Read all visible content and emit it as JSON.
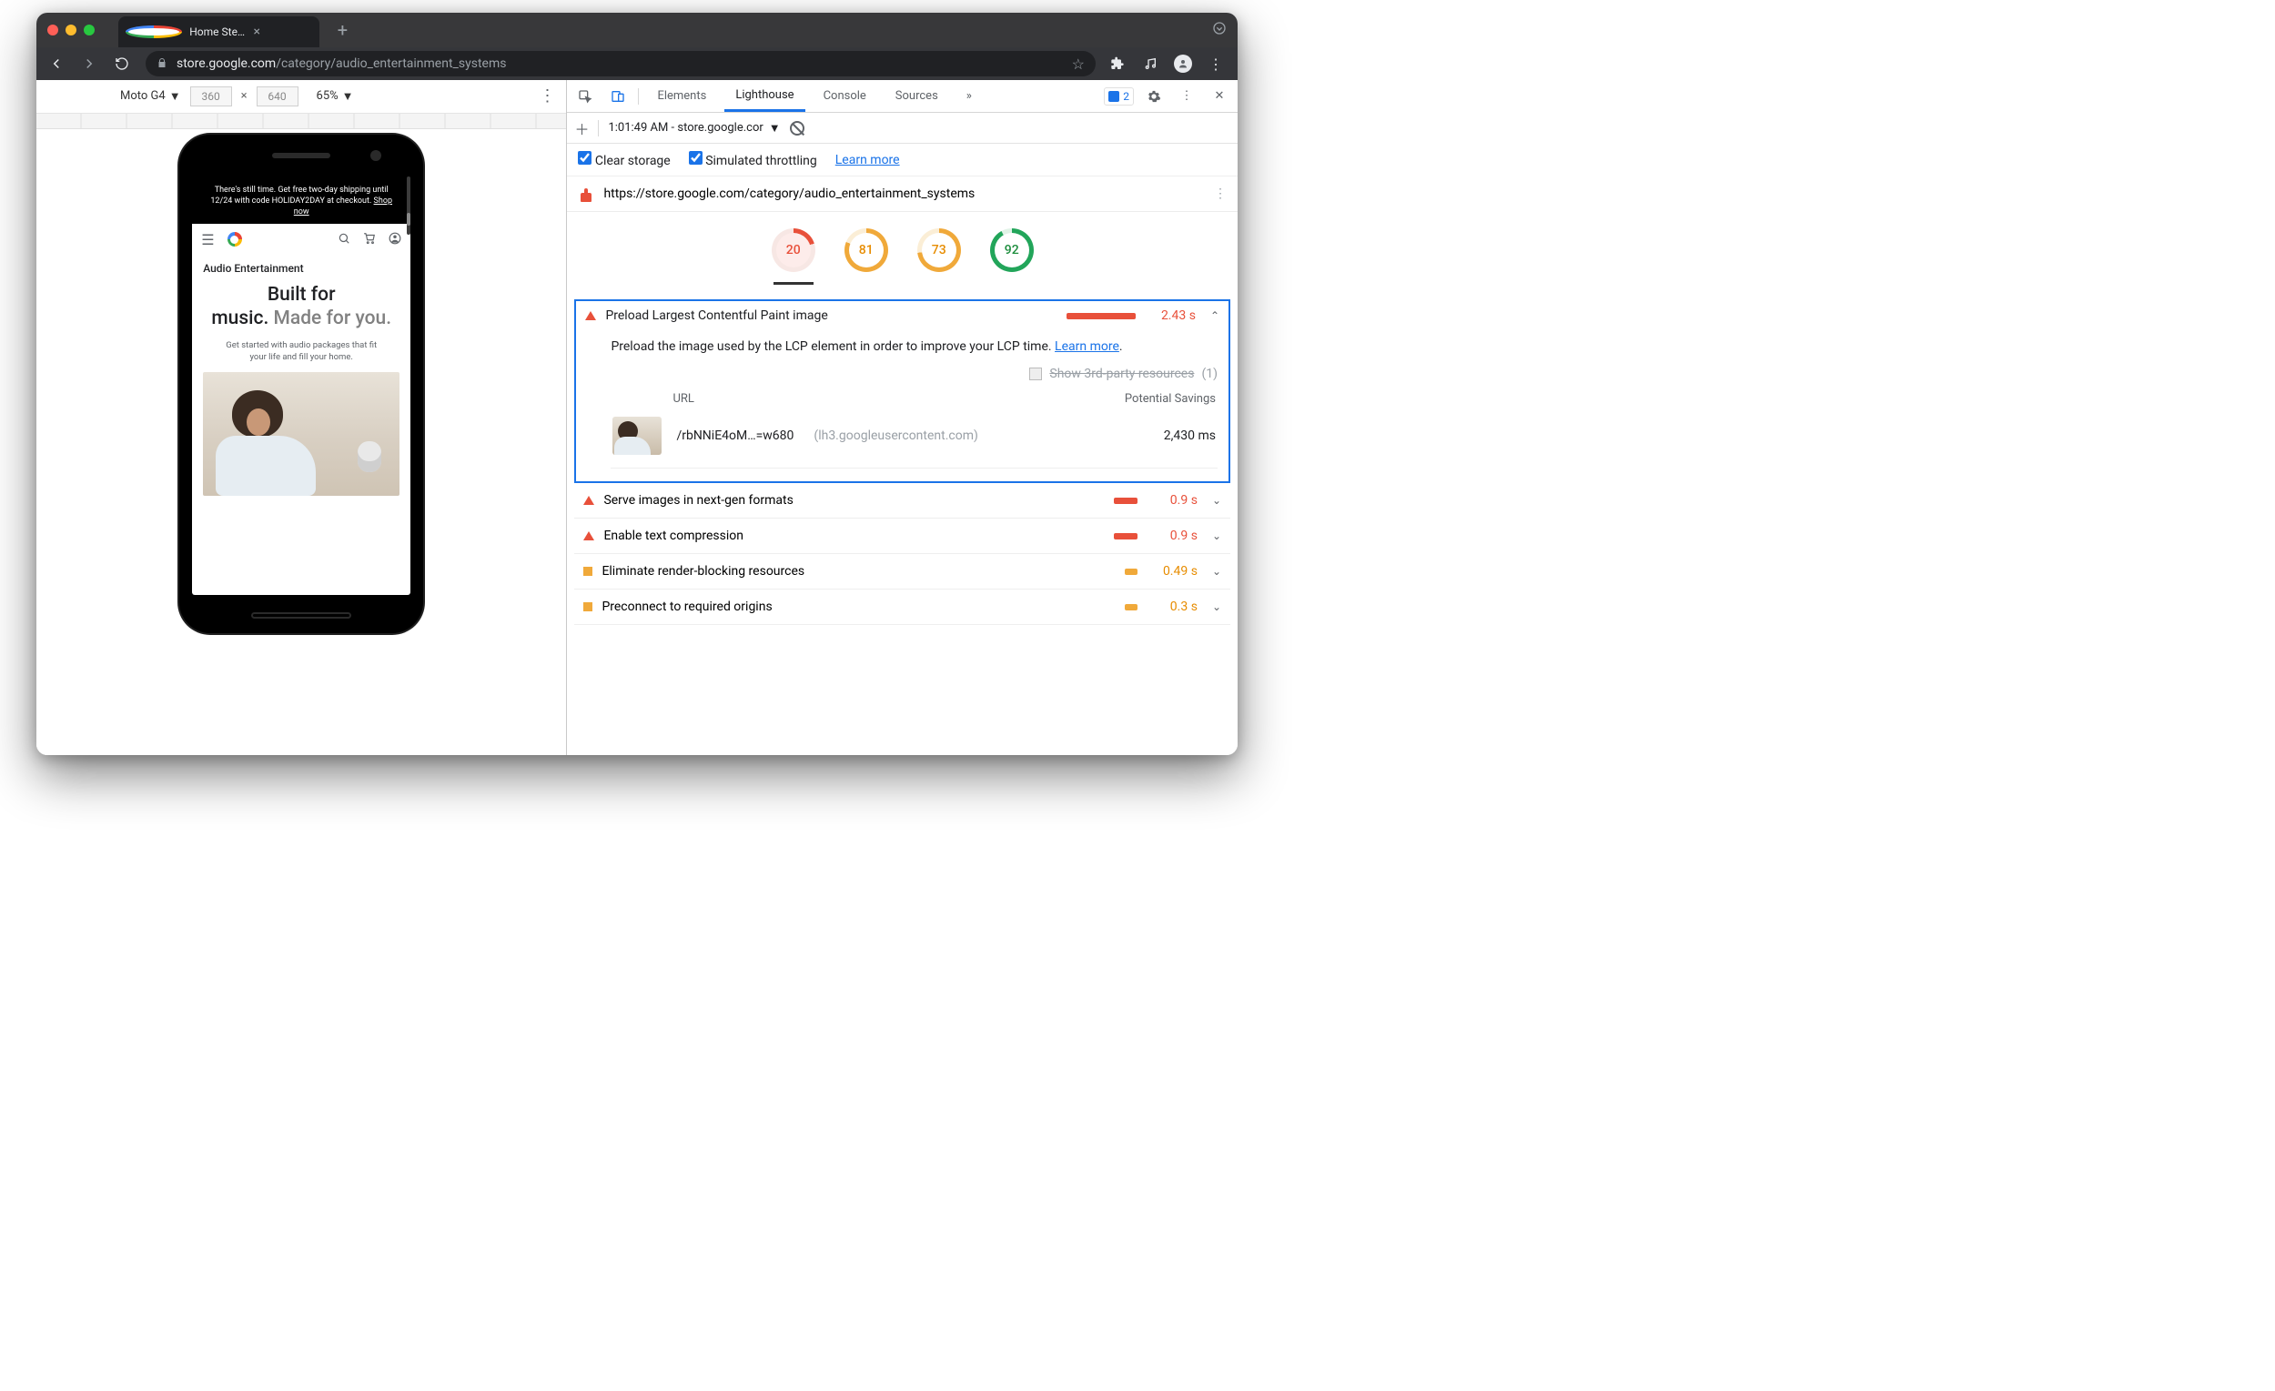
{
  "browser": {
    "tab_title": "Home Stereo & Audio Entertain",
    "url_full": "store.google.com/category/audio_entertainment_systems",
    "url_host": "store.google.com",
    "url_path": "/category/audio_entertainment_systems"
  },
  "emulation": {
    "device": "Moto G4",
    "width": "360",
    "height": "640",
    "zoom": "65%"
  },
  "phone_page": {
    "banner_line1": "There's still time. Get free two-day shipping until",
    "banner_line2": "12/24 with code HOLIDAY2DAY at checkout. ",
    "banner_cta": "Shop now",
    "section_title": "Audio Entertainment",
    "hero_black1": "Built for",
    "hero_black2": "music.",
    "hero_grey": " Made for you.",
    "sub": "Get started with audio packages that fit your life and fill your home."
  },
  "devtools": {
    "tabs": [
      "Elements",
      "Lighthouse",
      "Console",
      "Sources"
    ],
    "active_tab": "Lighthouse",
    "issues_count": "2",
    "report_time": "1:01:49 AM - store.google.cor",
    "clear_storage": "Clear storage",
    "throttling": "Simulated throttling",
    "learn_more": "Learn more",
    "target_url": "https://store.google.com/category/audio_entertainment_systems",
    "scores": {
      "perf": "20",
      "a11y": "81",
      "bp": "73",
      "seo": "92"
    }
  },
  "audit": {
    "title": "Preload Largest Contentful Paint image",
    "time": "2.43 s",
    "desc_a": "Preload the image used by the LCP element in order to improve your LCP time. ",
    "desc_link": "Learn more",
    "desc_b": ".",
    "third_party_label": "Show 3rd-party resources",
    "third_party_count": "(1)",
    "col_url": "URL",
    "col_savings": "Potential Savings",
    "row_path": "/rbNNiE4oM…=w680",
    "row_domain": "(lh3.googleusercontent.com)",
    "row_savings": "2,430 ms"
  },
  "other_audits": [
    {
      "icon": "tri",
      "title": "Serve images in next-gen formats",
      "barClass": "sm",
      "val": "0.9 s",
      "valClass": ""
    },
    {
      "icon": "tri",
      "title": "Enable text compression",
      "barClass": "sm",
      "val": "0.9 s",
      "valClass": ""
    },
    {
      "icon": "sq",
      "title": "Eliminate render-blocking resources",
      "barClass": "tiny amber",
      "val": "0.49 s",
      "valClass": "amber"
    },
    {
      "icon": "sq",
      "title": "Preconnect to required origins",
      "barClass": "tiny amber",
      "val": "0.3 s",
      "valClass": "amber"
    }
  ]
}
